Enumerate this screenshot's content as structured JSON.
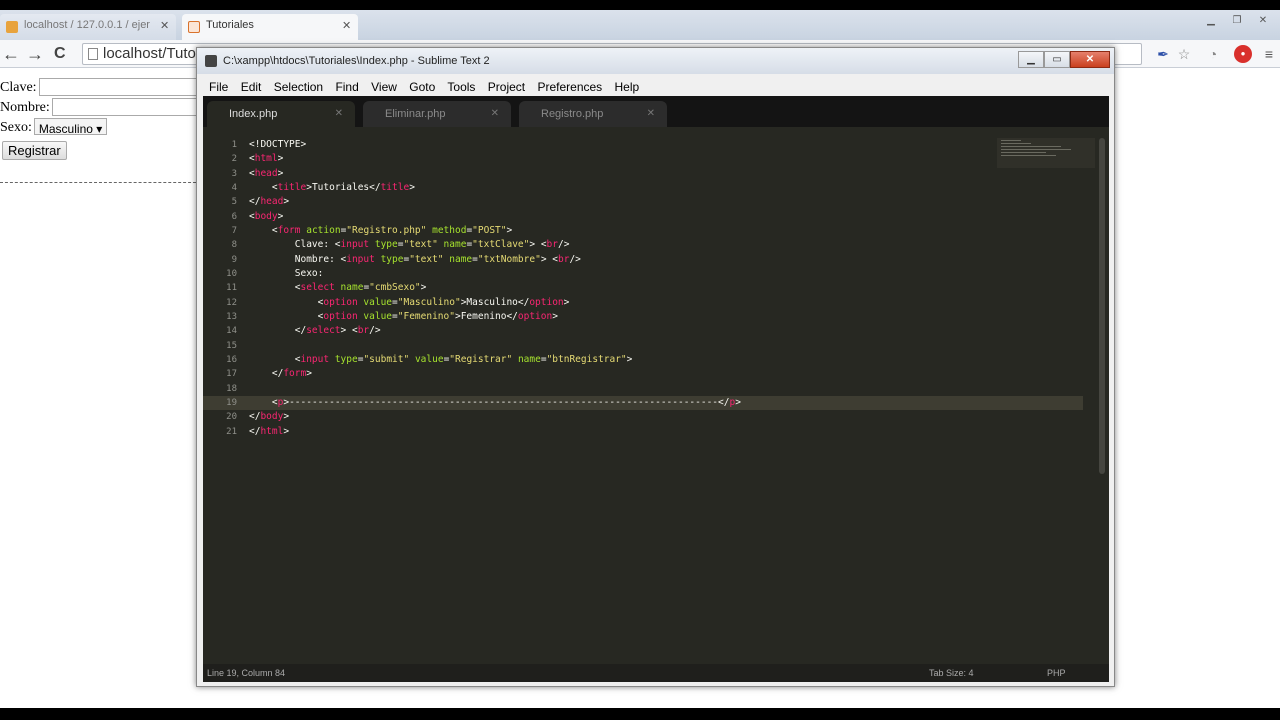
{
  "browser": {
    "tabs": [
      {
        "title": "localhost / 127.0.0.1 / ejer",
        "close": "✕"
      },
      {
        "title": "Tutoriales",
        "close": "✕"
      }
    ],
    "url": "localhost/Tuto",
    "back": "←",
    "forward": "→",
    "reload": "C"
  },
  "page": {
    "clave_label": "Clave:",
    "nombre_label": "Nombre:",
    "sexo_label": "Sexo:",
    "sexo_value": "Masculino",
    "submit_label": "Registrar"
  },
  "editor": {
    "title": "C:\\xampp\\htdocs\\Tutoriales\\Index.php - Sublime Text 2",
    "menu": [
      "File",
      "Edit",
      "Selection",
      "Find",
      "View",
      "Goto",
      "Tools",
      "Project",
      "Preferences",
      "Help"
    ],
    "tabs": [
      {
        "label": "Index.php",
        "active": true
      },
      {
        "label": "Eliminar.php",
        "active": false
      },
      {
        "label": "Registro.php",
        "active": false
      }
    ],
    "lines": [
      "<!DOCTYPE>",
      "<html>",
      "<head>",
      "    <title>Tutoriales</title>",
      "</head>",
      "<body>",
      "    <form action=\"Registro.php\" method=\"POST\">",
      "        Clave: <input type=\"text\" name=\"txtClave\"> <br/>",
      "        Nombre: <input type=\"text\" name=\"txtNombre\"> <br/>",
      "        Sexo:",
      "        <select name=\"cmbSexo\">",
      "            <option value=\"Masculino\">Masculino</option>",
      "            <option value=\"Femenino\">Femenino</option>",
      "        </select> <br/>",
      "",
      "        <input type=\"submit\" value=\"Registrar\" name=\"btnRegistrar\">",
      "    </form>",
      "",
      "    <p>---------------------------------------------------------------------------</p>",
      "</body>",
      "</html>"
    ],
    "status_left": "Line 19, Column 84",
    "tab_size": "Tab Size: 4",
    "syntax": "PHP"
  }
}
